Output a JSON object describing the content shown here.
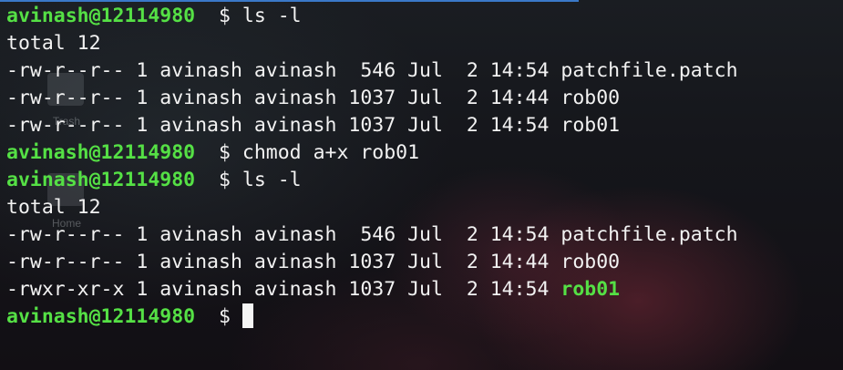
{
  "desktop": {
    "icons": [
      {
        "label": "Trash",
        "icon": "trash-icon"
      },
      {
        "label": "Home",
        "icon": "folder-icon"
      }
    ]
  },
  "terminal": {
    "prompt": "avinash@12114980",
    "prompt_symbol": "$",
    "lines": [
      {
        "type": "prompt",
        "command": "ls -l"
      },
      {
        "type": "output",
        "text": "total 12"
      },
      {
        "type": "output",
        "text": "-rw-r--r-- 1 avinash avinash  546 Jul  2 14:54 patchfile.patch"
      },
      {
        "type": "output",
        "text": "-rw-r--r-- 1 avinash avinash 1037 Jul  2 14:44 rob00"
      },
      {
        "type": "output",
        "text": "-rw-r--r-- 1 avinash avinash 1037 Jul  2 14:54 rob01"
      },
      {
        "type": "prompt",
        "command": "chmod a+x rob01"
      },
      {
        "type": "prompt",
        "command": "ls -l"
      },
      {
        "type": "output",
        "text": "total 12"
      },
      {
        "type": "output",
        "text": "-rw-r--r-- 1 avinash avinash  546 Jul  2 14:54 patchfile.patch"
      },
      {
        "type": "output",
        "text": "-rw-r--r-- 1 avinash avinash 1037 Jul  2 14:44 rob00"
      },
      {
        "type": "output_exec",
        "prefix": "-rwxr-xr-x 1 avinash avinash 1037 Jul  2 14:54 ",
        "file": "rob01"
      },
      {
        "type": "prompt_active",
        "command": ""
      }
    ],
    "colors": {
      "prompt": "#55e045",
      "text": "#f2f2f2",
      "executable": "#55e045",
      "cursor": "#f5f5f5"
    }
  }
}
